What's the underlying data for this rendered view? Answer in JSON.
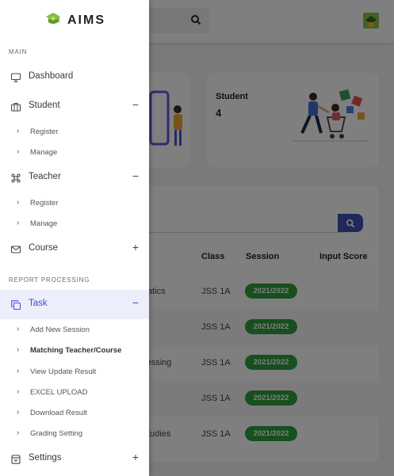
{
  "app": {
    "name": "AIMS"
  },
  "sidebar": {
    "sections": {
      "main": "MAIN",
      "report": "REPORT PROCESSING"
    },
    "dashboard": {
      "label": "Dashboard"
    },
    "student": {
      "label": "Student",
      "toggle": "−",
      "sub": [
        "Register",
        "Manage"
      ]
    },
    "teacher": {
      "label": "Teacher",
      "toggle": "−",
      "sub": [
        "Register",
        "Manage"
      ]
    },
    "course": {
      "label": "Course",
      "toggle": "+"
    },
    "task": {
      "label": "Task",
      "toggle": "−",
      "sub": [
        "Add New Session",
        "Matching Teacher/Course",
        "View Update Result",
        "EXCEL UPLOAD",
        "Download Result",
        "Grading Setting"
      ]
    },
    "settings": {
      "label": "Settings",
      "toggle": "+"
    },
    "chevron": "›"
  },
  "cards": [
    {
      "title": "Student",
      "count": "4"
    }
  ],
  "table": {
    "headers": {
      "class": "Class",
      "session": "Session",
      "input_score": "Input Score"
    },
    "rows": [
      {
        "subject": "atics",
        "class": "JSS 1A",
        "session": "2021/2022"
      },
      {
        "subject": "",
        "class": "JSS 1A",
        "session": "2021/2022"
      },
      {
        "subject": "ocessing",
        "class": "JSS 1A",
        "session": "2021/2022"
      },
      {
        "subject": "",
        "class": "JSS 1A",
        "session": "2021/2022"
      },
      {
        "subject": "tudies",
        "class": "JSS 1A",
        "session": "2021/2022"
      }
    ]
  },
  "colors": {
    "accent": "#4a4ad8",
    "badge": "#2e9e3e",
    "search_button": "#3f51b5"
  },
  "icons": {
    "dashboard": "monitor-icon",
    "student": "briefcase-icon",
    "teacher": "command-icon",
    "course": "mail-icon",
    "task": "copy-icon",
    "settings": "archive-icon"
  }
}
